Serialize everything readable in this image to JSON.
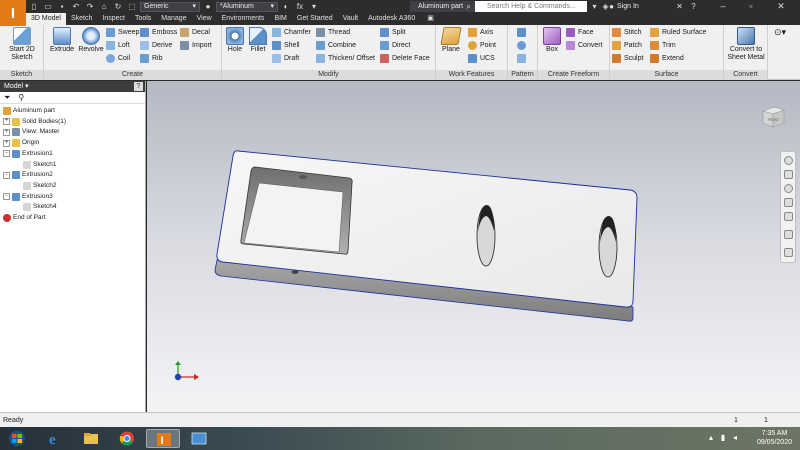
{
  "titlebar": {
    "app_logo": "I",
    "material_combo": "Generic",
    "appearance_combo": "*Aluminum",
    "document_title": "Aluminum part",
    "search_placeholder": "Search Help & Commands...",
    "sign_in": "Sign In"
  },
  "ribbon_tabs": [
    "3D Model",
    "Sketch",
    "Inspect",
    "Tools",
    "Manage",
    "View",
    "Environments",
    "BIM",
    "Get Started",
    "Vault",
    "Autodesk A360"
  ],
  "ribbon": {
    "sketch_panel": {
      "title": "Sketch",
      "start_sketch": "Start 2D Sketch"
    },
    "create_panel": {
      "title": "Create",
      "extrude": "Extrude",
      "revolve": "Revolve",
      "sweep": "Sweep",
      "emboss": "Emboss",
      "decal": "Decal",
      "loft": "Loft",
      "derive": "Derive",
      "import": "Import",
      "coil": "Coil",
      "rib": "Rib"
    },
    "modify_panel": {
      "title": "Modify",
      "hole": "Hole",
      "fillet": "Fillet",
      "chamfer": "Chamfer",
      "thread": "Thread",
      "split": "Split",
      "shell": "Shell",
      "combine": "Combine",
      "direct": "Direct",
      "draft": "Draft",
      "thicken": "Thicken/ Offset",
      "delete_face": "Delete Face"
    },
    "work_features_panel": {
      "title": "Work Features",
      "plane": "Plane",
      "axis": "Axis",
      "point": "Point",
      "ucs": "UCS"
    },
    "pattern_panel": {
      "title": "Pattern"
    },
    "freeform_panel": {
      "title": "Create Freeform",
      "box": "Box",
      "face": "Face",
      "convert": "Convert"
    },
    "surface_panel": {
      "title": "Surface",
      "stitch": "Stitch",
      "ruled_surface": "Ruled Surface",
      "patch": "Patch",
      "trim": "Trim",
      "sculpt": "Sculpt",
      "extend": "Extend"
    },
    "convert_panel": {
      "title": "Convert",
      "convert_sheet_metal": "Convert to Sheet Metal"
    }
  },
  "browser": {
    "header": "Model ▾",
    "help": "?",
    "tree": [
      {
        "label": "Aluminum part",
        "level": 0,
        "expander": "",
        "icon": "part"
      },
      {
        "label": "Solid Bodies(1)",
        "level": 0,
        "expander": "+",
        "icon": "folder"
      },
      {
        "label": "View: Master",
        "level": 0,
        "expander": "+",
        "icon": "view"
      },
      {
        "label": "Origin",
        "level": 0,
        "expander": "+",
        "icon": "folder"
      },
      {
        "label": "Extrusion1",
        "level": 0,
        "expander": "-",
        "icon": "extrude"
      },
      {
        "label": "Sketch1",
        "level": 1,
        "expander": "",
        "icon": "sketch"
      },
      {
        "label": "Extrusion2",
        "level": 0,
        "expander": "-",
        "icon": "extrude"
      },
      {
        "label": "Sketch2",
        "level": 1,
        "expander": "",
        "icon": "sketch"
      },
      {
        "label": "Extrusion3",
        "level": 0,
        "expander": "-",
        "icon": "extrude"
      },
      {
        "label": "Sketch4",
        "level": 1,
        "expander": "",
        "icon": "sketch"
      },
      {
        "label": "End of Part",
        "level": 0,
        "expander": "",
        "icon": "end"
      }
    ]
  },
  "viewport": {
    "viewcube_label": "FRONT"
  },
  "statusbar": {
    "text": "Ready",
    "count1": "1",
    "count2": "1"
  },
  "taskbar": {
    "time": "7:35 AM",
    "date": "09/05/2020"
  },
  "colors": {
    "accent": "#e07b18",
    "titlebar": "#2d2d30",
    "ribbon": "#f0f0f0",
    "part_face": "#f1f1f1",
    "selection_edge": "#1a2f9e"
  }
}
